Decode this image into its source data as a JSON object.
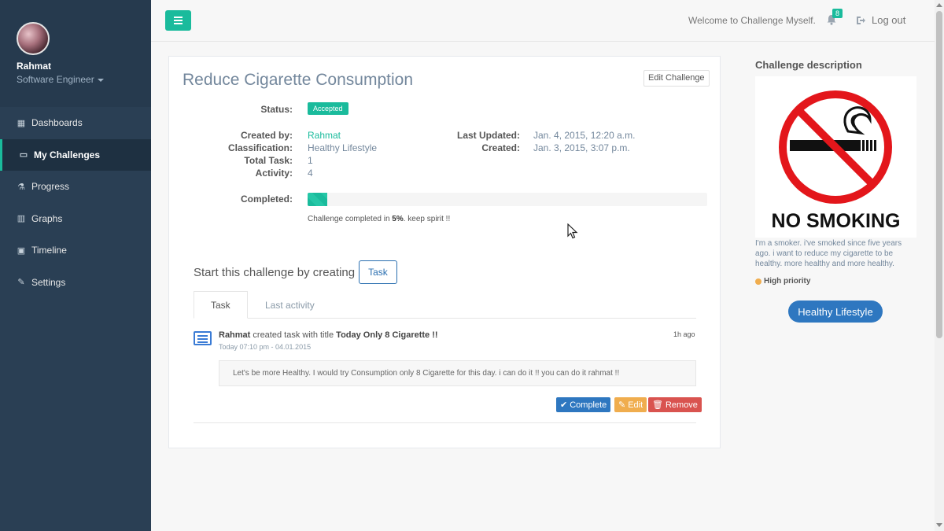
{
  "user": {
    "name": "Rahmat",
    "role": "Software Engineer"
  },
  "sidebar": {
    "items": [
      {
        "label": "Dashboards",
        "icon": "grid-icon"
      },
      {
        "label": "My Challenges",
        "icon": "desktop-icon",
        "active": true
      },
      {
        "label": "Progress",
        "icon": "flask-icon"
      },
      {
        "label": "Graphs",
        "icon": "bar-chart-icon"
      },
      {
        "label": "Timeline",
        "icon": "picture-icon"
      },
      {
        "label": "Settings",
        "icon": "wrench-icon"
      }
    ]
  },
  "topbar": {
    "welcome": "Welcome to Challenge Myself.",
    "notifications": "8",
    "logout": "Log out"
  },
  "challenge": {
    "title": "Reduce Cigarette Consumption",
    "edit_label": "Edit Challenge",
    "status_label": "Status:",
    "status": "Accepted",
    "created_by_label": "Created by:",
    "created_by": "Rahmat",
    "classification_label": "Classification:",
    "classification": "Healthy Lifestyle",
    "total_task_label": "Total Task:",
    "total_task": "1",
    "activity_label": "Activity:",
    "activity": "4",
    "last_updated_label": "Last Updated:",
    "last_updated": "Jan. 4, 2015, 12:20 a.m.",
    "created_label": "Created:",
    "created": "Jan. 3, 2015, 3:07 p.m.",
    "completed_label": "Completed:",
    "progress_percent": 5,
    "progress_note_pre": "Challenge completed in ",
    "progress_note_value": "5%",
    "progress_note_post": ". keep spirit !!",
    "start_text": "Start this challenge by creating",
    "task_button": "Task"
  },
  "tabs": [
    {
      "label": "Task"
    },
    {
      "label": "Last activity"
    }
  ],
  "entry": {
    "author": "Rahmat",
    "action": " created task with title ",
    "task_title": "Today Only 8 Cigarette !!",
    "time_ago": "1h ago",
    "date": "Today 07:10 pm - 04.01.2015",
    "body": "Let's be more Healthy. I would try Consumption only 8 Cigarette for this day. i can do it !! you can do it rahmat !!",
    "complete_label": "Complete",
    "edit_label": "Edit",
    "remove_label": "Remove"
  },
  "description": {
    "heading": "Challenge description",
    "image_caption": "NO SMOKING",
    "text": "I'm a smoker. i've smoked since five years ago. i want to reduce my cigarette to be healthy. more healthy and more healthy.",
    "priority": "High priority",
    "category": "Healthy Lifestyle"
  }
}
